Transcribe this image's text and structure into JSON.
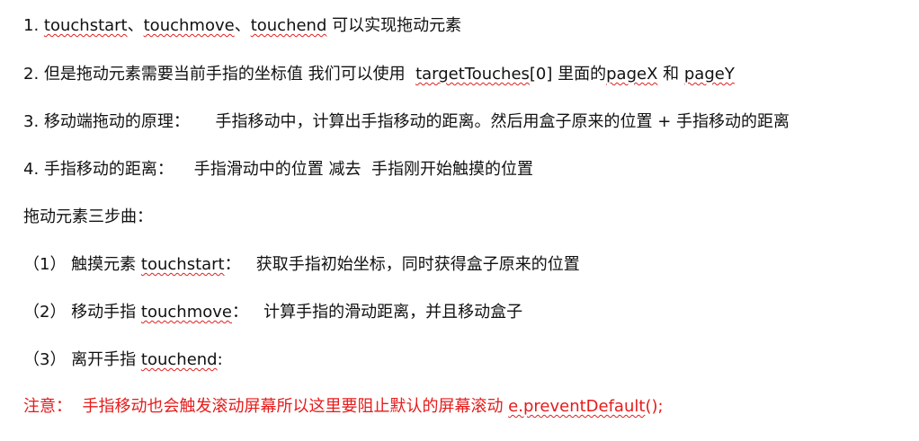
{
  "document": {
    "lines": [
      {
        "segments": [
          {
            "t": "1. "
          },
          {
            "t": "touchstart",
            "sq": true
          },
          {
            "t": "、"
          },
          {
            "t": "touchmove",
            "sq": true
          },
          {
            "t": "、"
          },
          {
            "t": "touchend",
            "sq": true
          },
          {
            "t": " 可以实现拖动元素"
          }
        ]
      },
      {
        "segments": [
          {
            "t": "2. 但是拖动元素需要当前手指的坐标值 我们可以使用  "
          },
          {
            "t": "targetTouches",
            "sq": true
          },
          {
            "t": "[0] 里面的"
          },
          {
            "t": "pageX",
            "sq": true
          },
          {
            "t": " 和 "
          },
          {
            "t": "pageY",
            "sq": true
          }
        ]
      },
      {
        "segments": [
          {
            "t": "3. 移动端拖动的原理：     手指移动中，计算出手指移动的距离。然后用盒子原来的位置 + 手指移动的距离"
          }
        ]
      },
      {
        "segments": [
          {
            "t": "4. 手指移动的距离：    手指滑动中的位置 减去  手指刚开始触摸的位置"
          }
        ]
      },
      {
        "segments": [
          {
            "t": "拖动元素三步曲："
          }
        ]
      },
      {
        "segments": [
          {
            "t": "（1） 触摸元素 "
          },
          {
            "t": "touchstart",
            "sq": true
          },
          {
            "t": "：   获取手指初始坐标，同时获得盒子原来的位置"
          }
        ]
      },
      {
        "segments": [
          {
            "t": "（2） 移动手指 "
          },
          {
            "t": "touchmove",
            "sq": true
          },
          {
            "t": "：   计算手指的滑动距离，并且移动盒子"
          }
        ]
      },
      {
        "segments": [
          {
            "t": "（3） 离开手指 "
          },
          {
            "t": "touchend",
            "sq": true
          },
          {
            "t": ":"
          }
        ]
      },
      {
        "red": true,
        "segments": [
          {
            "t": "注意：  手指移动也会触发滚动屏幕所以这里要阻止默认的屏幕滚动 "
          },
          {
            "t": "e.preventDefault",
            "sq": true
          },
          {
            "t": "();"
          }
        ]
      }
    ]
  },
  "colors": {
    "text": "#111111",
    "warning": "#e51b1b",
    "spellcheck": "#e02020"
  }
}
